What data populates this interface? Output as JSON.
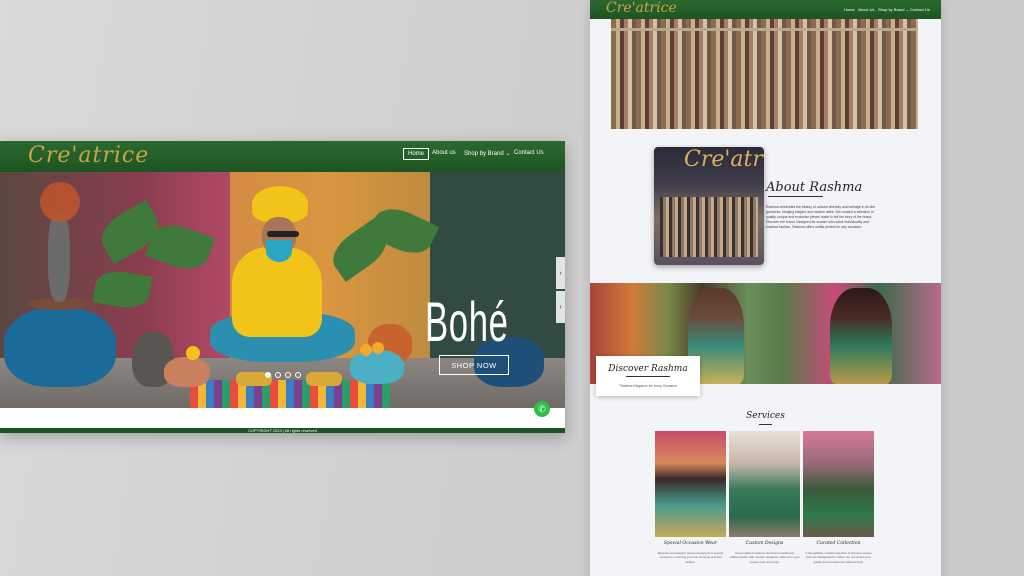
{
  "desktop": {
    "brand": "Cre'atrice",
    "nav": [
      {
        "label": "Home",
        "active": true
      },
      {
        "label": "About us",
        "active": false
      },
      {
        "label": "Shop by Brand",
        "active": false,
        "dropdown": true
      },
      {
        "label": "Contact Us",
        "active": false
      }
    ],
    "hero": {
      "title": "Bohé",
      "button": "SHOP NOW",
      "slides": 4,
      "active_slide": 1
    },
    "arrows": {
      "prev": "‹",
      "next": "›"
    },
    "whatsapp_icon": "whatsapp-icon",
    "footer": "COPYRIGHT 2024 | All rights reserved"
  },
  "page": {
    "brand": "Cre'atrice",
    "nav": [
      {
        "label": "Home"
      },
      {
        "label": "About Us"
      },
      {
        "label": "Shop by Brand",
        "dropdown": true
      },
      {
        "label": "Contact Us"
      }
    ],
    "store_sign": "Cre'atrice",
    "about": {
      "title": "About Rashma",
      "text": "Rashma celebrates the beauty of cultural diversity and heritage in its fine garments, bringing elegant and modern attire. We curated a selection of quality, unique and exclusive pieces made to tell the story of the brand, Discover the brand, Designed for women who value individuality and timeless fashion. Rashma offers outfits perfect for any occasion."
    },
    "discover": {
      "title": "Discover Rashma",
      "subtitle": "Timeless Elegance for every Occasion"
    },
    "services": {
      "title": "Services",
      "items": [
        {
          "name": "Special Occasion Wear",
          "desc": "Bespoke and elegant pieces designed for special occasions, ensuring you look stunning and feel radiant."
        },
        {
          "name": "Custom Designs",
          "desc": "Personalized creations that blend traditional craftsmanship with modern elegance, tailored to your unique style and body."
        },
        {
          "name": "Curated Collection",
          "desc": "A thoughtfully curated selection of timeless pieces that are handpicked to reflect our commitment to quality and exceptional craftsmanship."
        }
      ]
    }
  },
  "colors": {
    "header_green": "#1e5423",
    "gold": "#c9a24a",
    "whatsapp": "#2fbf4a"
  }
}
